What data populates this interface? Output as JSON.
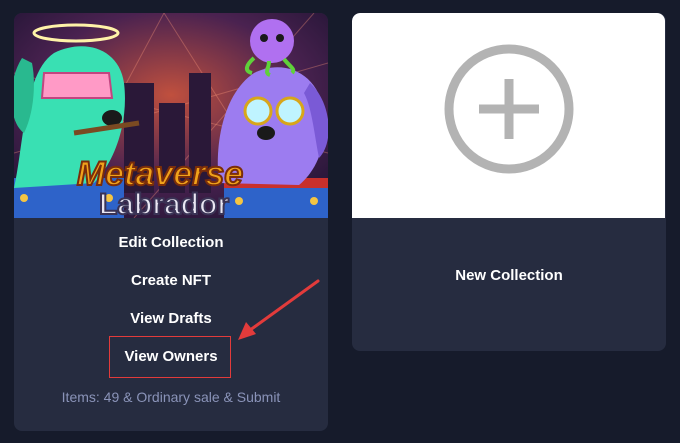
{
  "collection_card": {
    "cover_title_line1": "Metaverse",
    "cover_title_line2": "Labrador",
    "actions": {
      "edit": "Edit Collection",
      "create": "Create NFT",
      "drafts": "View Drafts",
      "owners": "View Owners"
    },
    "meta": "Items: 49 & Ordinary sale & Submit"
  },
  "new_collection_card": {
    "label": "New Collection",
    "icon": "plus-circle-icon"
  },
  "annotation": {
    "arrow_color": "#e23b3b",
    "highlight_color": "#e23b3b"
  }
}
